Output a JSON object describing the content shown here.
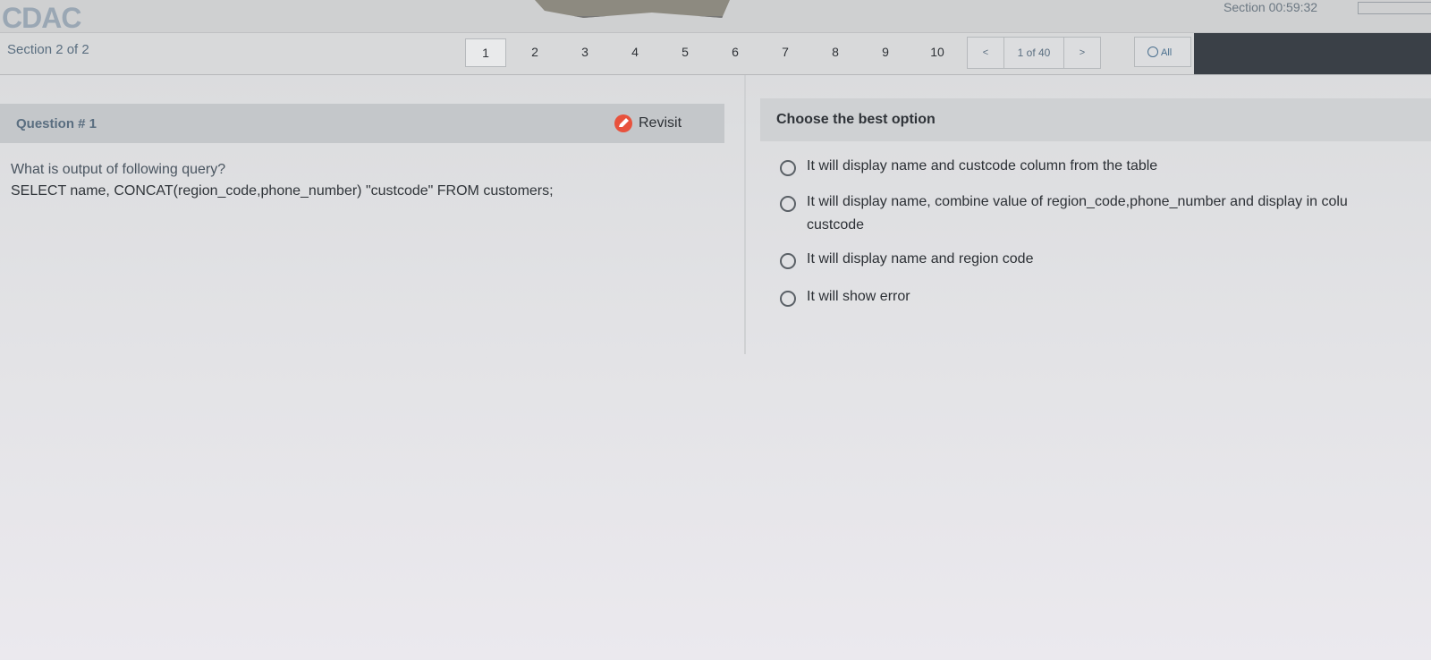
{
  "header": {
    "logo_text": "CDAC",
    "timer": "Section 00:59:32"
  },
  "nav": {
    "section_label": "Section 2 of 2",
    "questions": [
      "1",
      "2",
      "3",
      "4",
      "5",
      "6",
      "7",
      "8",
      "9",
      "10"
    ],
    "active_question": "1",
    "pager_prev": "<",
    "pager_text": "1 of 40",
    "pager_next": ">",
    "filter_label": "All"
  },
  "question": {
    "title": "Question # 1",
    "revisit_label": "Revisit",
    "text_line1": "What is output of following query?",
    "text_line2": "SELECT name, CONCAT(region_code,phone_number) \"custcode\" FROM customers;"
  },
  "options": {
    "header": "Choose the best option",
    "items": [
      {
        "line1": "It will display name and custcode column from the table",
        "line2": ""
      },
      {
        "line1": "It will display name, combine value of region_code,phone_number and display in colu",
        "line2": "custcode"
      },
      {
        "line1": "It will display name and region code",
        "line2": ""
      },
      {
        "line1": "It will show error",
        "line2": ""
      }
    ]
  },
  "colors": {
    "revisit_icon": "#e8523d",
    "dark_bar": "#3a4047"
  }
}
